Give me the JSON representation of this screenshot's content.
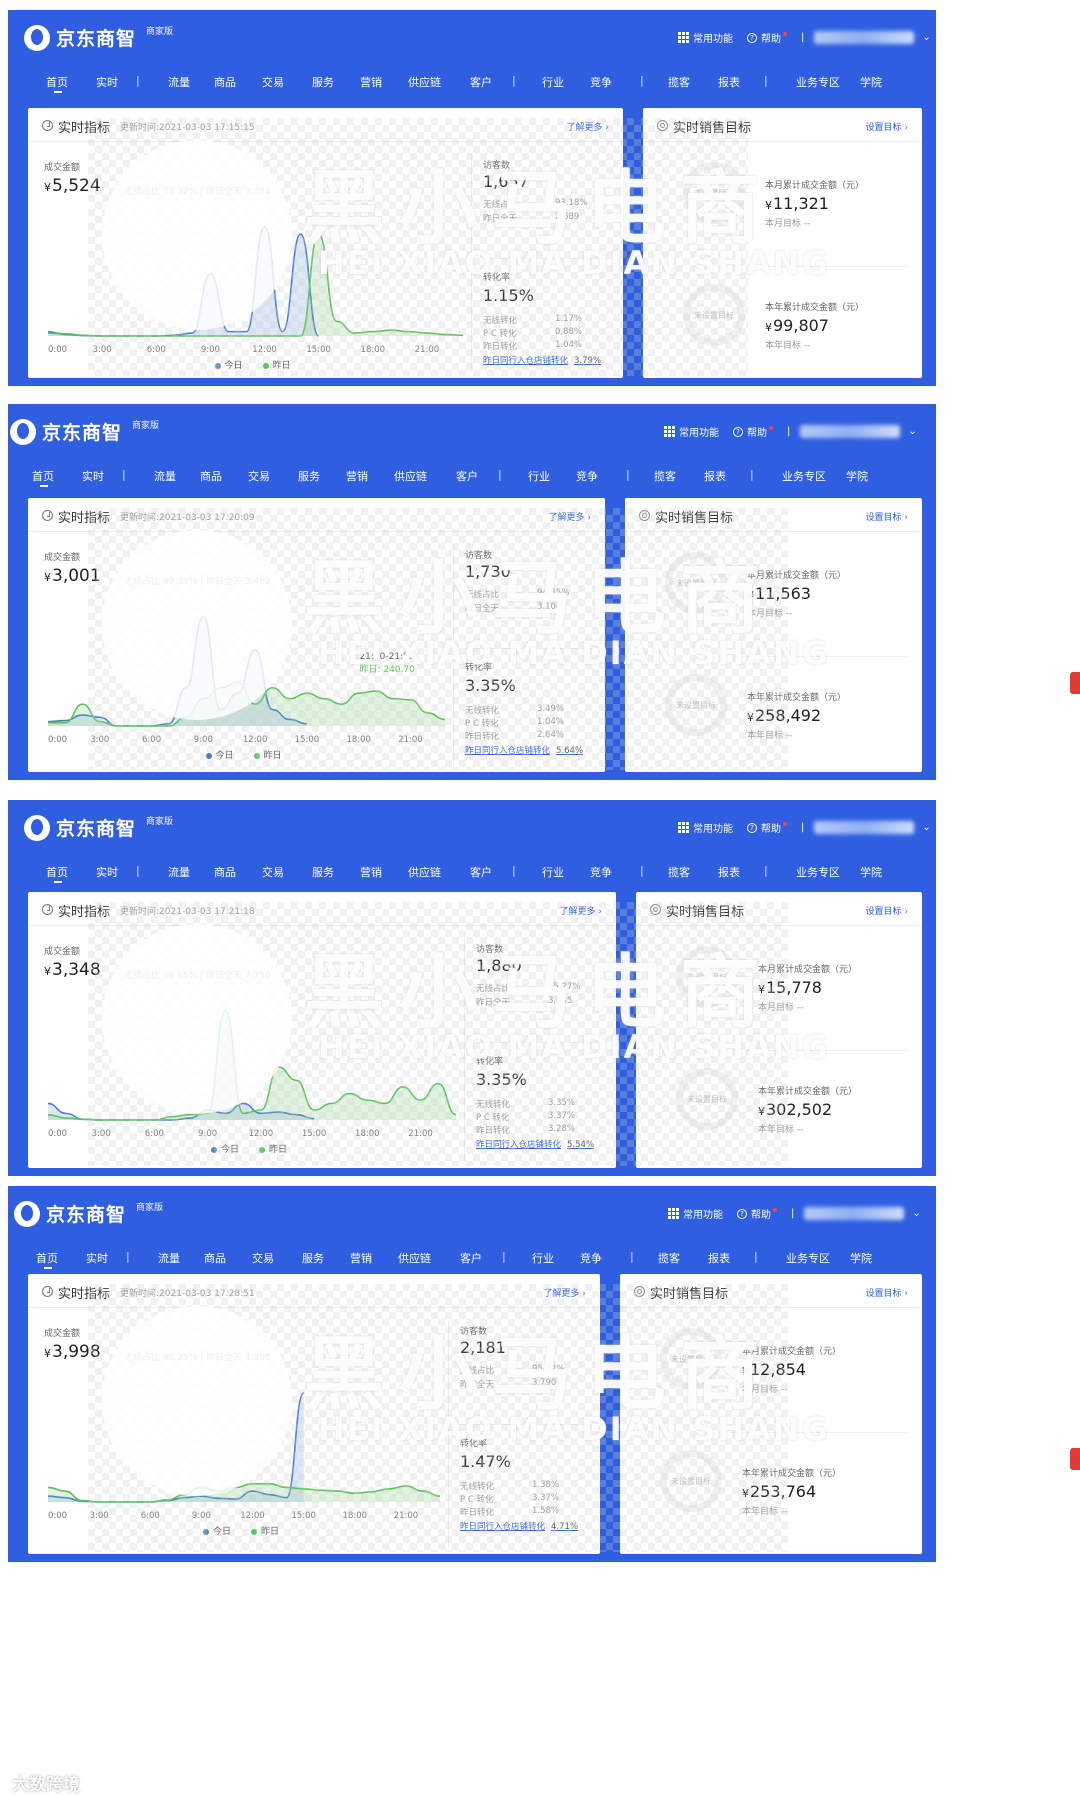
{
  "app": {
    "brand": "京东商智",
    "brand_tag": "商家版",
    "tools": {
      "common_functions": "常用功能",
      "help": "帮助"
    },
    "nav": [
      "首页",
      "实时",
      "|",
      "流量",
      "商品",
      "交易",
      "服务",
      "营销",
      "供应链",
      "客户",
      "|",
      "行业",
      "竞争",
      "|",
      "揽客",
      "报表",
      "|",
      "业务专区",
      "学院"
    ]
  },
  "labels": {
    "realtime_title": "实时指标",
    "update_prefix": "更新时间:",
    "learn_more": "了解更多 ›",
    "sales_target_title": "实时销售目标",
    "set_target": "设置目标 ›",
    "gmv_label": "成交金额",
    "wireless_share": "无线占比",
    "yesterday_full": "昨日全天",
    "visitors_label": "访客数",
    "wireless_share_short": "无线占比",
    "yesterday_full_short": "昨日全天",
    "conversion_label": "转化率",
    "wireless_conv": "无线转化",
    "pc_conv": "P C 转化",
    "yesterday_conv": "昨日转化",
    "peer_link": "昨日同行入仓店铺转化",
    "month_cum": "本月累计成交金额（元）",
    "month_target": "本月目标 --",
    "year_cum": "本年累计成交金额（元）",
    "year_target": "本年目标 --",
    "no_target": "未设置目标",
    "legend_today": "今日",
    "legend_yesterday": "昨日",
    "currency": "¥"
  },
  "colors": {
    "brand_blue": "#2f5fe0",
    "today_line": "#4a7fd4",
    "yesterday_line": "#59c45a",
    "link": "#2f5fe0"
  },
  "watermark": {
    "cn": "黑小马电商",
    "en": "HEI XIAO MA DIAN SHANG",
    "footer": "大数跨境"
  },
  "panels": [
    {
      "update_time": "2021-03-03 17:15:15",
      "gmv": "5,524",
      "wireless_share": "73.32%",
      "yesterday_full": "3,384",
      "visitors": "1,657",
      "visitors_wireless": "93.18%",
      "visitors_yesterday": "2,689",
      "conversion": "1.15%",
      "conv_wireless": "1.17%",
      "conv_pc": "0.88%",
      "conv_yesterday": "1.04%",
      "peer_conv": "3.79%",
      "month_cum": "11,321",
      "year_cum": "99,807",
      "tooltip": null
    },
    {
      "update_time": "2021-03-03 17:20:09",
      "gmv": "3,001",
      "wireless_share": "99.33%",
      "yesterday_full": "3,482",
      "visitors": "1,730",
      "visitors_wireless": "94.45%",
      "visitors_yesterday": "3,104",
      "conversion": "3.35%",
      "conv_wireless": "3.49%",
      "conv_pc": "1.04%",
      "conv_yesterday": "2.64%",
      "peer_conv": "5.64%",
      "month_cum": "11,563",
      "year_cum": "258,492",
      "tooltip": {
        "range": "21:00-21:59",
        "value": "昨日: 240.70"
      }
    },
    {
      "update_time": "2021-03-03 17:21:18",
      "gmv": "3,348",
      "wireless_share": "96.65%",
      "yesterday_full": "7,750",
      "visitors": "1,880",
      "visitors_wireless": "95.27%",
      "visitors_yesterday": "3,685",
      "conversion": "3.35%",
      "conv_wireless": "3.35%",
      "conv_pc": "3.37%",
      "conv_yesterday": "3.28%",
      "peer_conv": "5.54%",
      "month_cum": "15,778",
      "year_cum": "302,502",
      "tooltip": null
    },
    {
      "update_time": "2021-03-03 17:28:51",
      "gmv": "3,998",
      "wireless_share": "90.25%",
      "yesterday_full": "4,398",
      "visitors": "2,181",
      "visitors_wireless": "95.92%",
      "visitors_yesterday": "3,790",
      "conversion": "1.47%",
      "conv_wireless": "1.38%",
      "conv_pc": "3.37%",
      "conv_yesterday": "1.58%",
      "peer_conv": "4.71%",
      "month_cum": "12,854",
      "year_cum": "253,764",
      "tooltip": null
    }
  ],
  "chart_data": [
    {
      "type": "area",
      "x": [
        "0:00",
        "1:00",
        "2:00",
        "3:00",
        "4:00",
        "5:00",
        "6:00",
        "7:00",
        "8:00",
        "9:00",
        "10:00",
        "11:00",
        "12:00",
        "13:00",
        "14:00",
        "15:00",
        "16:00",
        "17:00",
        "18:00",
        "19:00",
        "20:00",
        "21:00",
        "22:00",
        "23:00"
      ],
      "x_ticks": [
        "0:00",
        "3:00",
        "6:00",
        "9:00",
        "12:00",
        "15:00",
        "18:00",
        "21:00"
      ],
      "series": [
        {
          "name": "今日",
          "values": [
            60,
            20,
            5,
            0,
            0,
            0,
            0,
            10,
            40,
            850,
            60,
            60,
            1500,
            60,
            1400,
            0,
            null,
            null,
            null,
            null,
            null,
            null,
            null,
            null
          ]
        },
        {
          "name": "昨日",
          "values": [
            40,
            30,
            10,
            0,
            0,
            0,
            0,
            0,
            0,
            0,
            0,
            0,
            0,
            0,
            0,
            1400,
            200,
            40,
            60,
            80,
            60,
            40,
            20,
            10
          ]
        }
      ]
    },
    {
      "type": "area",
      "x": [
        "0:00",
        "1:00",
        "2:00",
        "3:00",
        "4:00",
        "5:00",
        "6:00",
        "7:00",
        "8:00",
        "9:00",
        "10:00",
        "11:00",
        "12:00",
        "13:00",
        "14:00",
        "15:00",
        "16:00",
        "17:00",
        "18:00",
        "19:00",
        "20:00",
        "21:00",
        "22:00",
        "23:00"
      ],
      "x_ticks": [
        "0:00",
        "3:00",
        "6:00",
        "9:00",
        "12:00",
        "15:00",
        "18:00",
        "21:00"
      ],
      "series": [
        {
          "name": "今日",
          "values": [
            40,
            50,
            100,
            80,
            0,
            0,
            0,
            20,
            350,
            1000,
            150,
            300,
            700,
            150,
            60,
            20,
            null,
            null,
            null,
            null,
            null,
            null,
            null,
            null
          ]
        },
        {
          "name": "昨日",
          "values": [
            30,
            30,
            200,
            40,
            0,
            0,
            0,
            0,
            80,
            250,
            350,
            400,
            200,
            350,
            250,
            300,
            250,
            200,
            300,
            320,
            250,
            240,
            120,
            60
          ]
        }
      ]
    },
    {
      "type": "area",
      "x": [
        "0:00",
        "1:00",
        "2:00",
        "3:00",
        "4:00",
        "5:00",
        "6:00",
        "7:00",
        "8:00",
        "9:00",
        "10:00",
        "11:00",
        "12:00",
        "13:00",
        "14:00",
        "15:00",
        "16:00",
        "17:00",
        "18:00",
        "19:00",
        "20:00",
        "21:00",
        "22:00",
        "23:00"
      ],
      "x_ticks": [
        "0:00",
        "3:00",
        "6:00",
        "9:00",
        "12:00",
        "15:00",
        "18:00",
        "21:00"
      ],
      "series": [
        {
          "name": "今日",
          "values": [
            250,
            100,
            10,
            0,
            0,
            0,
            0,
            0,
            30,
            150,
            100,
            250,
            100,
            120,
            80,
            20,
            null,
            null,
            null,
            null,
            null,
            null,
            null,
            null
          ]
        },
        {
          "name": "昨日",
          "values": [
            80,
            30,
            10,
            0,
            0,
            0,
            0,
            50,
            80,
            100,
            1650,
            100,
            150,
            800,
            600,
            150,
            250,
            400,
            300,
            250,
            500,
            300,
            550,
            80
          ]
        }
      ]
    },
    {
      "type": "area",
      "x": [
        "0:00",
        "1:00",
        "2:00",
        "3:00",
        "4:00",
        "5:00",
        "6:00",
        "7:00",
        "8:00",
        "9:00",
        "10:00",
        "11:00",
        "12:00",
        "13:00",
        "14:00",
        "15:00",
        "16:00",
        "17:00",
        "18:00",
        "19:00",
        "20:00",
        "21:00",
        "22:00",
        "23:00"
      ],
      "x_ticks": [
        "0:00",
        "3:00",
        "6:00",
        "9:00",
        "12:00",
        "15:00",
        "18:00",
        "21:00"
      ],
      "series": [
        {
          "name": "今日",
          "values": [
            80,
            60,
            10,
            0,
            0,
            0,
            0,
            20,
            60,
            80,
            50,
            40,
            150,
            100,
            60,
            1500,
            null,
            null,
            null,
            null,
            null,
            null,
            null,
            null
          ]
        },
        {
          "name": "昨日",
          "values": [
            200,
            150,
            20,
            0,
            0,
            0,
            0,
            30,
            100,
            200,
            150,
            200,
            250,
            250,
            200,
            180,
            160,
            150,
            120,
            140,
            180,
            220,
            150,
            80
          ]
        }
      ]
    }
  ]
}
